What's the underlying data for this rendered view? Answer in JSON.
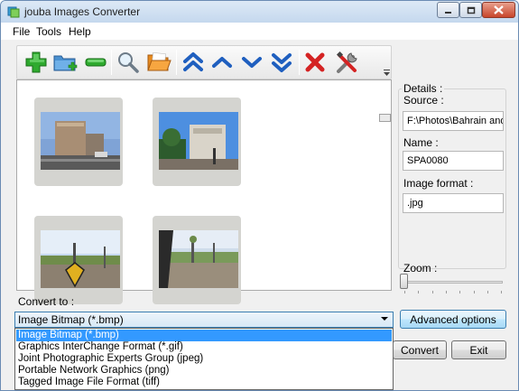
{
  "window": {
    "title": "jouba Images Converter"
  },
  "menu": [
    "File",
    "Tools",
    "Help"
  ],
  "toolbar_icons": [
    "add-image-icon",
    "add-folder-icon",
    "remove-image-icon",
    "search-icon",
    "open-folder-icon",
    "move-top-icon",
    "move-up-icon",
    "move-down-icon",
    "move-bottom-icon",
    "delete-icon",
    "tools-icon"
  ],
  "details": {
    "title": "Details :",
    "source_label": "Source :",
    "source_value": "F:\\Photos\\Bahrain and D",
    "name_label": "Name :",
    "name_value": "SPA0080",
    "format_label": "Image format :",
    "format_value": ".jpg"
  },
  "zoom": {
    "label": "Zoom :",
    "level": 0
  },
  "convert": {
    "label": "Convert to :",
    "selected": "Image Bitmap (*.bmp)",
    "options": [
      "Image Bitmap (*.bmp)",
      "Graphics InterChange Format (*.gif)",
      "Joint Photographic Experts Group (jpeg)",
      "Portable Network Graphics (png)",
      "Tagged Image File Format (tiff)"
    ]
  },
  "buttons": {
    "advanced": "Advanced options",
    "convert": "Convert",
    "exit": "Exit"
  },
  "colors": {
    "accent": "#3399ff",
    "title_bar": "#c5d8ee",
    "close_button": "#c8452b"
  }
}
